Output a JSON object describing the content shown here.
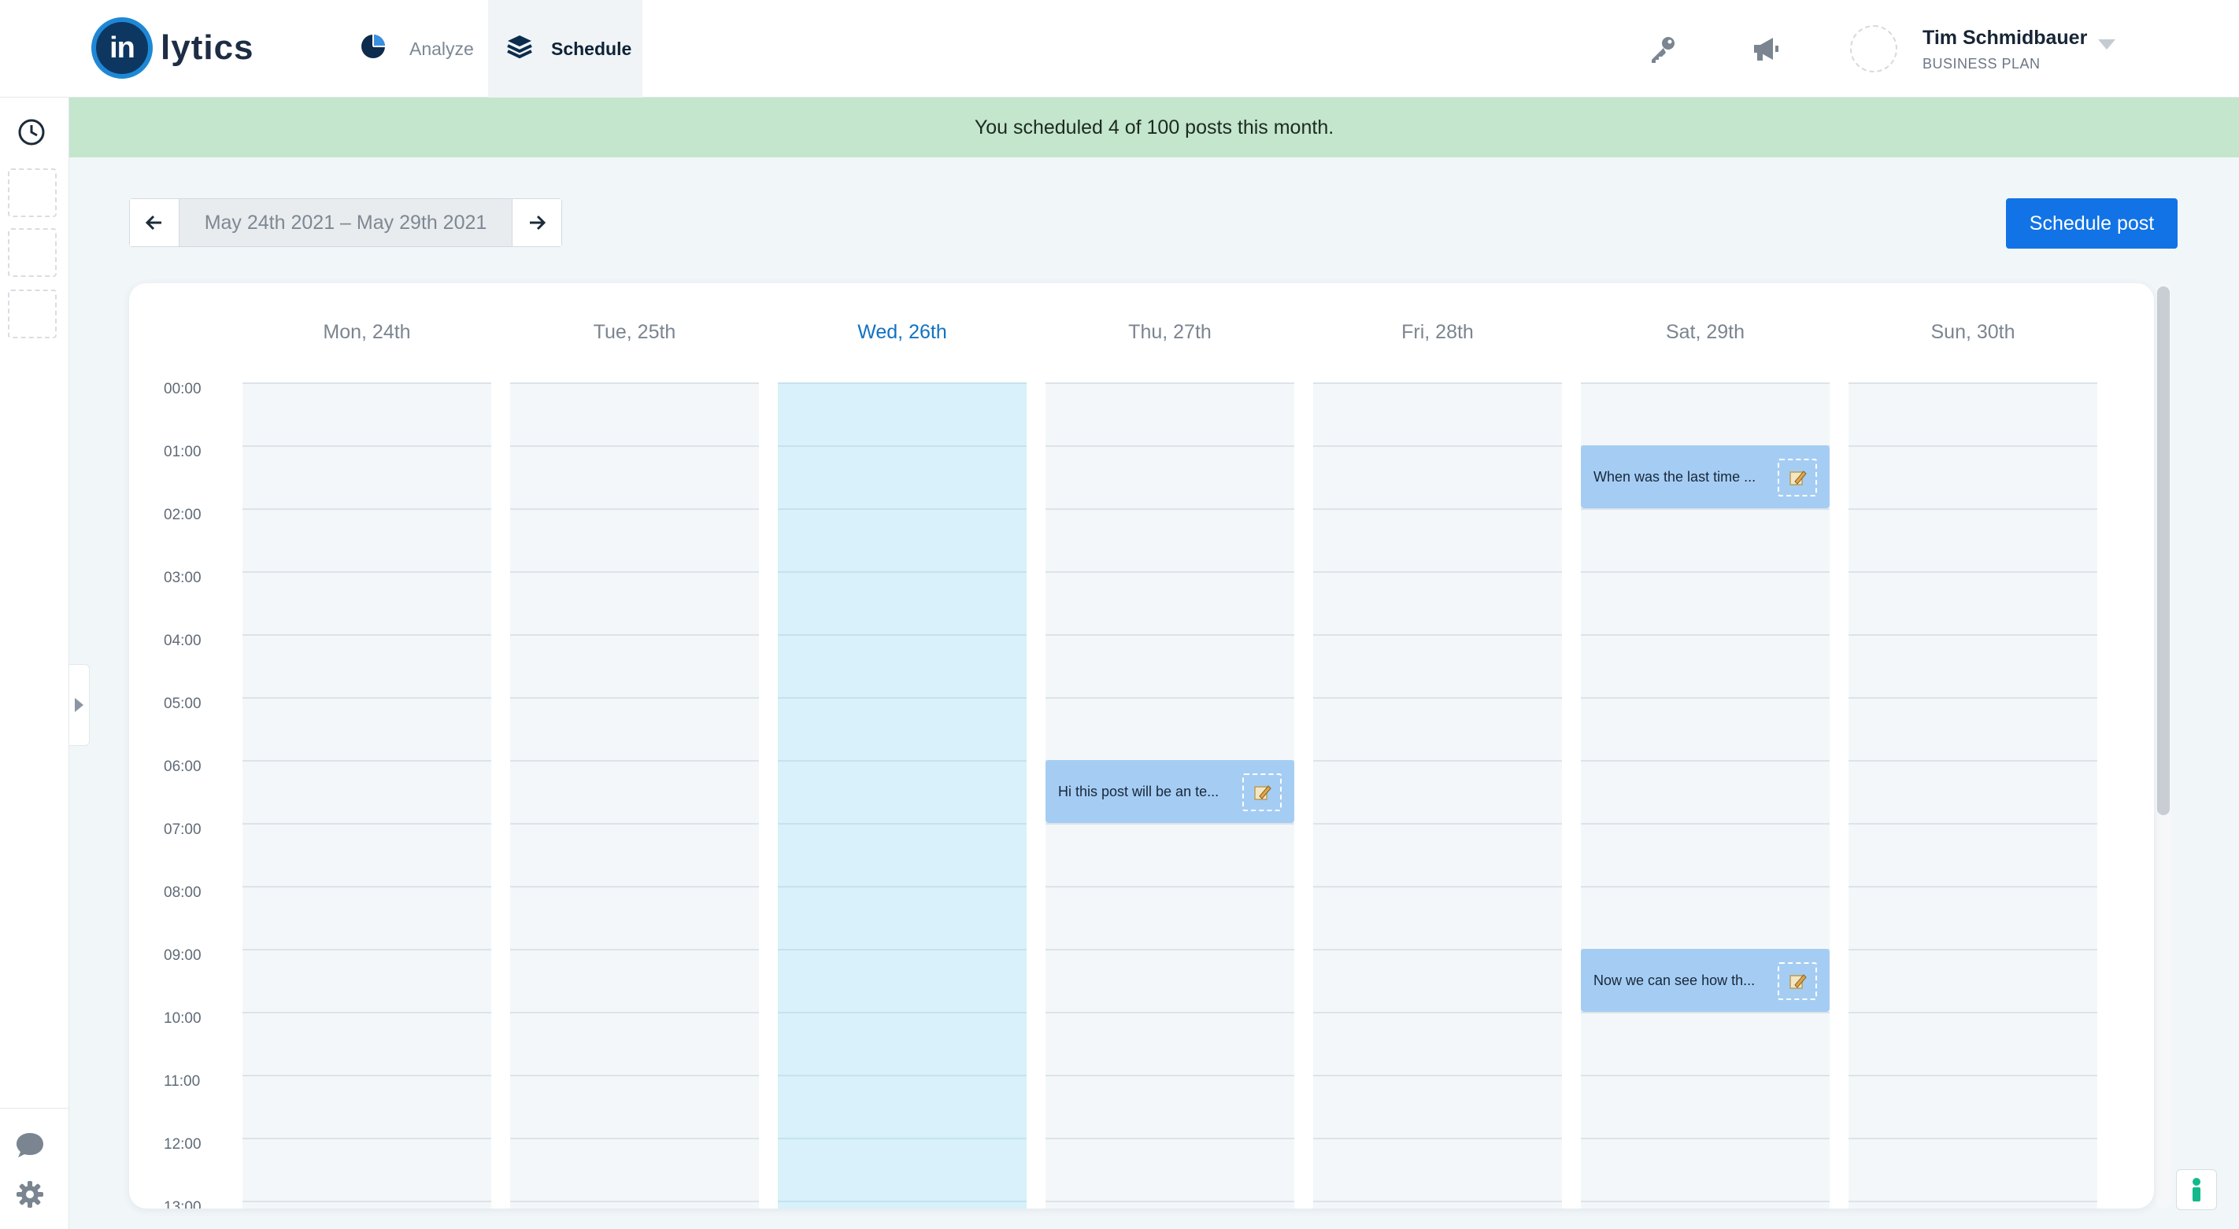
{
  "app": {
    "logo_mark": "in",
    "logo_text": "lytics"
  },
  "nav": {
    "analyze": "Analyze",
    "schedule": "Schedule",
    "active": "Schedule"
  },
  "user": {
    "name": "Tim Schmidbauer",
    "plan": "BUSINESS PLAN"
  },
  "banner": {
    "text": "You scheduled 4 of 100 posts this month."
  },
  "date_nav": {
    "range": "May 24th 2021 – May 29th 2021"
  },
  "actions": {
    "schedule_post": "Schedule post"
  },
  "calendar": {
    "days": [
      "Mon, 24th",
      "Tue, 25th",
      "Wed, 26th",
      "Thu, 27th",
      "Fri, 28th",
      "Sat, 29th",
      "Sun, 30th"
    ],
    "today_index": 2,
    "hours": [
      "00:00",
      "01:00",
      "02:00",
      "03:00",
      "04:00",
      "05:00",
      "06:00",
      "07:00",
      "08:00",
      "09:00",
      "10:00",
      "11:00",
      "12:00",
      "13:00"
    ],
    "events": [
      {
        "day_index": 5,
        "hour": 1,
        "text": "When was the last time ..."
      },
      {
        "day_index": 3,
        "hour": 6,
        "text": "Hi this post will be an te..."
      },
      {
        "day_index": 5,
        "hour": 9,
        "text": "Now we can see how th..."
      }
    ]
  },
  "colors": {
    "accent": "#1273e6",
    "banner_bg": "#c3e6cc",
    "event_bg": "#a5cdf3",
    "today_col": "#d8f1fa",
    "today_text": "#1272c2"
  },
  "icons": {
    "analyze": "pie-chart-icon",
    "schedule": "layers-icon",
    "key": "key-icon",
    "announce": "megaphone-icon",
    "history": "clock-icon",
    "chat": "chat-icon",
    "settings": "gear-icon",
    "event": "pencil-note-icon",
    "help": "help-icon"
  }
}
